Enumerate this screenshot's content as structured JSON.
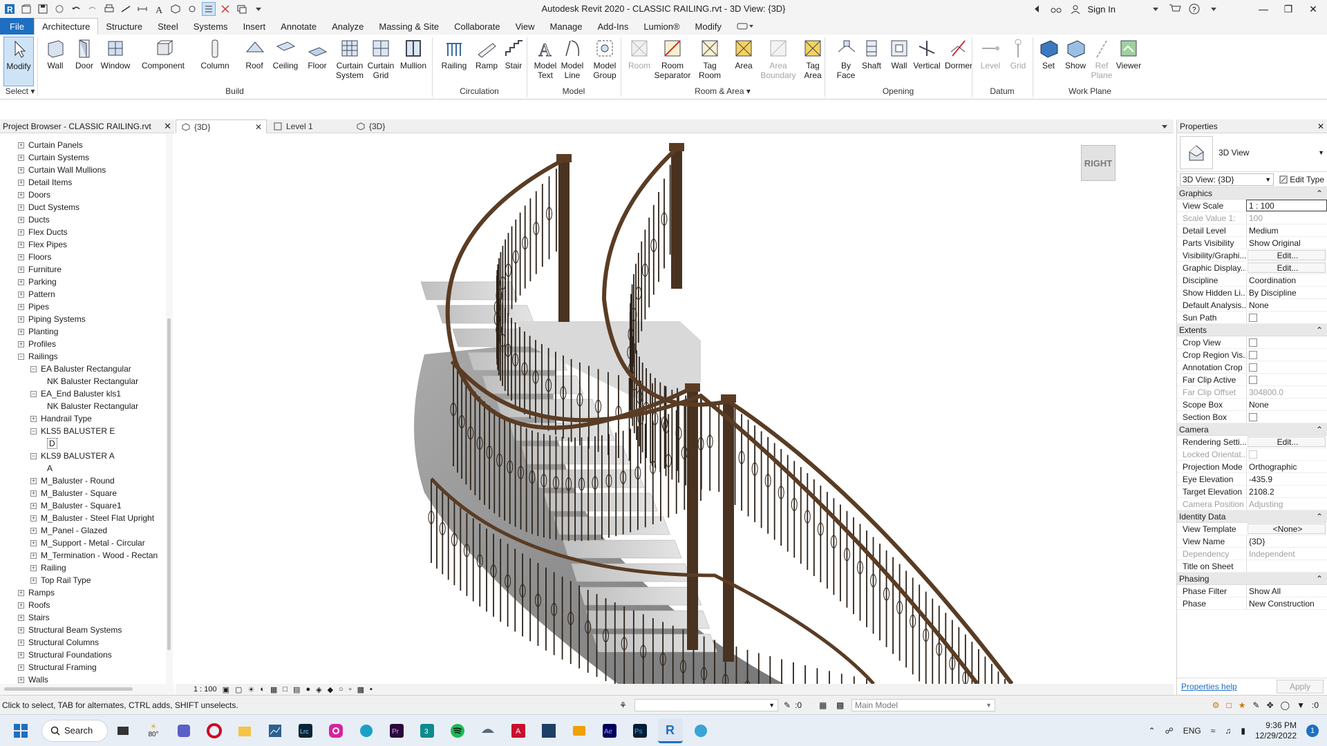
{
  "app": {
    "title": "Autodesk Revit 2020 - CLASSIC RAILING.rvt - 3D View: {3D}",
    "sign_in": "Sign In"
  },
  "menu": {
    "tabs": [
      "File",
      "Architecture",
      "Structure",
      "Steel",
      "Systems",
      "Insert",
      "Annotate",
      "Analyze",
      "Massing & Site",
      "Collaborate",
      "View",
      "Manage",
      "Add-Ins",
      "Lumion®",
      "Modify"
    ],
    "active": "Architecture"
  },
  "ribbon": {
    "tools": {
      "modify": "Modify",
      "wall": "Wall",
      "door": "Door",
      "window": "Window",
      "component": "Component",
      "column": "Column",
      "roof": "Roof",
      "ceiling": "Ceiling",
      "floor": "Floor",
      "curtain_system_1": "Curtain",
      "curtain_system_2": "System",
      "curtain_grid_1": "Curtain",
      "curtain_grid_2": "Grid",
      "mullion": "Mullion",
      "railing": "Railing",
      "ramp": "Ramp",
      "stair": "Stair",
      "model_text_1": "Model",
      "model_text_2": "Text",
      "model_line_1": "Model",
      "model_line_2": "Line",
      "model_group_1": "Model",
      "model_group_2": "Group",
      "room": "Room",
      "room_sep_1": "Room",
      "room_sep_2": "Separator",
      "tag_room_1": "Tag",
      "tag_room_2": "Room",
      "area": "Area",
      "area_boundary_1": "Area",
      "area_boundary_2": "Boundary",
      "tag_area_1": "Tag",
      "tag_area_2": "Area",
      "by_face_1": "By",
      "by_face_2": "Face",
      "shaft": "Shaft",
      "wall_opening": "Wall",
      "vertical": "Vertical",
      "dormer": "Dormer",
      "level": "Level",
      "grid": "Grid",
      "set": "Set",
      "show": "Show",
      "ref_plane_1": "Ref",
      "ref_plane_2": "Plane",
      "viewer": "Viewer"
    },
    "groups": {
      "select": "Select",
      "build": "Build",
      "circulation": "Circulation",
      "model": "Model",
      "room_area": "Room & Area",
      "opening": "Opening",
      "datum": "Datum",
      "work_plane": "Work Plane"
    }
  },
  "project_browser": {
    "title": "Project Browser - CLASSIC RAILING.rvt",
    "items": [
      {
        "label": "Curtain Panels",
        "level": 0,
        "expanded": false
      },
      {
        "label": "Curtain Systems",
        "level": 0,
        "expanded": false
      },
      {
        "label": "Curtain Wall Mullions",
        "level": 0,
        "expanded": false
      },
      {
        "label": "Detail Items",
        "level": 0,
        "expanded": false
      },
      {
        "label": "Doors",
        "level": 0,
        "expanded": false
      },
      {
        "label": "Duct Systems",
        "level": 0,
        "expanded": false
      },
      {
        "label": "Ducts",
        "level": 0,
        "expanded": false
      },
      {
        "label": "Flex Ducts",
        "level": 0,
        "expanded": false
      },
      {
        "label": "Flex Pipes",
        "level": 0,
        "expanded": false
      },
      {
        "label": "Floors",
        "level": 0,
        "expanded": false
      },
      {
        "label": "Furniture",
        "level": 0,
        "expanded": false
      },
      {
        "label": "Parking",
        "level": 0,
        "expanded": false
      },
      {
        "label": "Pattern",
        "level": 0,
        "expanded": false
      },
      {
        "label": "Pipes",
        "level": 0,
        "expanded": false
      },
      {
        "label": "Piping Systems",
        "level": 0,
        "expanded": false
      },
      {
        "label": "Planting",
        "level": 0,
        "expanded": false
      },
      {
        "label": "Profiles",
        "level": 0,
        "expanded": false
      },
      {
        "label": "Railings",
        "level": 0,
        "expanded": true
      },
      {
        "label": "EA Baluster Rectangular",
        "level": 1,
        "expanded": true
      },
      {
        "label": "NK Baluster Rectangular",
        "level": 2,
        "leaf": true
      },
      {
        "label": "EA_End Baluster kls1",
        "level": 1,
        "expanded": true
      },
      {
        "label": "NK Baluster Rectangular",
        "level": 2,
        "leaf": true
      },
      {
        "label": "Handrail Type",
        "level": 1,
        "expanded": false
      },
      {
        "label": "KLS5 BALUSTER E",
        "level": 1,
        "expanded": true
      },
      {
        "label": "D",
        "level": 2,
        "leaf": true,
        "selected": true
      },
      {
        "label": "KLS9 BALUSTER A",
        "level": 1,
        "expanded": true
      },
      {
        "label": "A",
        "level": 2,
        "leaf": true
      },
      {
        "label": "M_Baluster - Round",
        "level": 1,
        "expanded": false
      },
      {
        "label": "M_Baluster - Square",
        "level": 1,
        "expanded": false
      },
      {
        "label": "M_Baluster - Square1",
        "level": 1,
        "expanded": false
      },
      {
        "label": "M_Baluster - Steel Flat Upright",
        "level": 1,
        "expanded": false
      },
      {
        "label": "M_Panel - Glazed",
        "level": 1,
        "expanded": false
      },
      {
        "label": "M_Support - Metal - Circular",
        "level": 1,
        "expanded": false
      },
      {
        "label": "M_Termination - Wood - Rectan",
        "level": 1,
        "expanded": false
      },
      {
        "label": "Railing",
        "level": 1,
        "expanded": false
      },
      {
        "label": "Top Rail Type",
        "level": 1,
        "expanded": false
      },
      {
        "label": "Ramps",
        "level": 0,
        "expanded": false
      },
      {
        "label": "Roofs",
        "level": 0,
        "expanded": false
      },
      {
        "label": "Stairs",
        "level": 0,
        "expanded": false
      },
      {
        "label": "Structural Beam Systems",
        "level": 0,
        "expanded": false
      },
      {
        "label": "Structural Columns",
        "level": 0,
        "expanded": false
      },
      {
        "label": "Structural Foundations",
        "level": 0,
        "expanded": false
      },
      {
        "label": "Structural Framing",
        "level": 0,
        "expanded": false
      },
      {
        "label": "Walls",
        "level": 0,
        "expanded": false
      }
    ]
  },
  "view_tabs": {
    "tab1": "{3D}",
    "tab2": "Level 1",
    "tab3": "{3D}"
  },
  "viewcube": {
    "face": "RIGHT"
  },
  "view_bar": {
    "scale": "1 : 100"
  },
  "properties": {
    "title": "Properties",
    "type_name": "3D View",
    "selector": "3D View: {3D}",
    "edit_type": "Edit Type",
    "categories": [
      {
        "name": "Graphics",
        "rows": [
          {
            "k": "View Scale",
            "v": "1 : 100",
            "kind": "input"
          },
          {
            "k": "Scale Value    1:",
            "v": "100",
            "dis": true
          },
          {
            "k": "Detail Level",
            "v": "Medium"
          },
          {
            "k": "Parts Visibility",
            "v": "Show Original"
          },
          {
            "k": "Visibility/Graphi...",
            "v": "Edit...",
            "kind": "button"
          },
          {
            "k": "Graphic Display...",
            "v": "Edit...",
            "kind": "button"
          },
          {
            "k": "Discipline",
            "v": "Coordination"
          },
          {
            "k": "Show Hidden Li...",
            "v": "By Discipline"
          },
          {
            "k": "Default Analysis...",
            "v": "None"
          },
          {
            "k": "Sun Path",
            "v": "",
            "kind": "check"
          }
        ]
      },
      {
        "name": "Extents",
        "rows": [
          {
            "k": "Crop View",
            "v": "",
            "kind": "check"
          },
          {
            "k": "Crop Region Vis...",
            "v": "",
            "kind": "check"
          },
          {
            "k": "Annotation Crop",
            "v": "",
            "kind": "check"
          },
          {
            "k": "Far Clip Active",
            "v": "",
            "kind": "check"
          },
          {
            "k": "Far Clip Offset",
            "v": "304800.0",
            "dis": true
          },
          {
            "k": "Scope Box",
            "v": "None"
          },
          {
            "k": "Section Box",
            "v": "",
            "kind": "check"
          }
        ]
      },
      {
        "name": "Camera",
        "rows": [
          {
            "k": "Rendering Setti...",
            "v": "Edit...",
            "kind": "button"
          },
          {
            "k": "Locked Orientat...",
            "v": "",
            "kind": "check",
            "dis": true
          },
          {
            "k": "Projection Mode",
            "v": "Orthographic"
          },
          {
            "k": "Eye Elevation",
            "v": "-435.9"
          },
          {
            "k": "Target Elevation",
            "v": "2108.2"
          },
          {
            "k": "Camera Position",
            "v": "Adjusting",
            "dis": true
          }
        ]
      },
      {
        "name": "Identity Data",
        "rows": [
          {
            "k": "View Template",
            "v": "<None>",
            "kind": "button"
          },
          {
            "k": "View Name",
            "v": "{3D}"
          },
          {
            "k": "Dependency",
            "v": "Independent",
            "dis": true
          },
          {
            "k": "Title on Sheet",
            "v": ""
          }
        ]
      },
      {
        "name": "Phasing",
        "rows": [
          {
            "k": "Phase Filter",
            "v": "Show All"
          },
          {
            "k": "Phase",
            "v": "New Construction"
          }
        ]
      }
    ],
    "help": "Properties help",
    "apply": "Apply"
  },
  "status": {
    "hint": "Click to select, TAB for alternates, CTRL adds, SHIFT unselects.",
    "count": ":0",
    "model": "Main Model",
    "filter_count": ":0"
  },
  "taskbar": {
    "search": "Search",
    "weather": "80°",
    "lang": "ENG",
    "time": "9:36 PM",
    "date": "12/29/2022",
    "notif": "1"
  },
  "colors": {
    "accent": "#1e6fc1",
    "rail": "#5a3c24",
    "stair": "#cfcfcf"
  }
}
